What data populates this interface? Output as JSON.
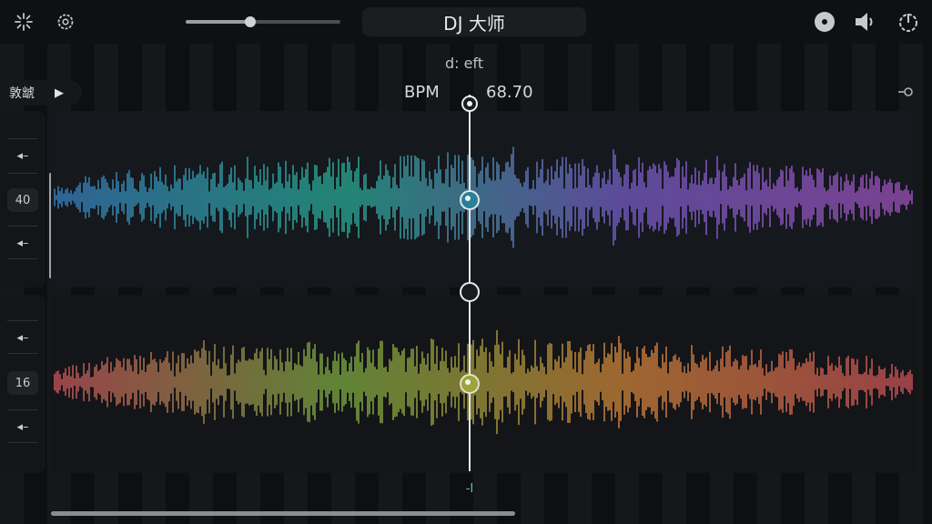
{
  "app": {
    "title": "DJ 大师"
  },
  "topbar": {
    "left_icons": [
      "sparkle-icon",
      "settings-icon"
    ],
    "crossfader": {
      "value": 0.42
    },
    "right_icons": [
      "vinyl-icon",
      "speaker-icon",
      "power-icon"
    ]
  },
  "deck_header": {
    "label": "敦䖓",
    "play_glyph": "▶",
    "effect_label": "d: eft",
    "bpm_label": "BPM",
    "bpm_value": "68.70",
    "search_icon": "search-icon"
  },
  "deck_a": {
    "side_buttons": {
      "top": "◂–",
      "value": "40",
      "bottom": "◂–"
    },
    "wave_colors": [
      "#3a84c8",
      "#28b39a",
      "#7d5fd0",
      "#a454c2"
    ]
  },
  "deck_b": {
    "side_buttons": {
      "top": "◂–",
      "value": "16",
      "bottom": "◂–"
    },
    "wave_colors": [
      "#d2585e",
      "#7fb342",
      "#d9893a",
      "#d2545a"
    ]
  },
  "bottom_marker": "-I",
  "scroll": {
    "position": 0.5
  }
}
